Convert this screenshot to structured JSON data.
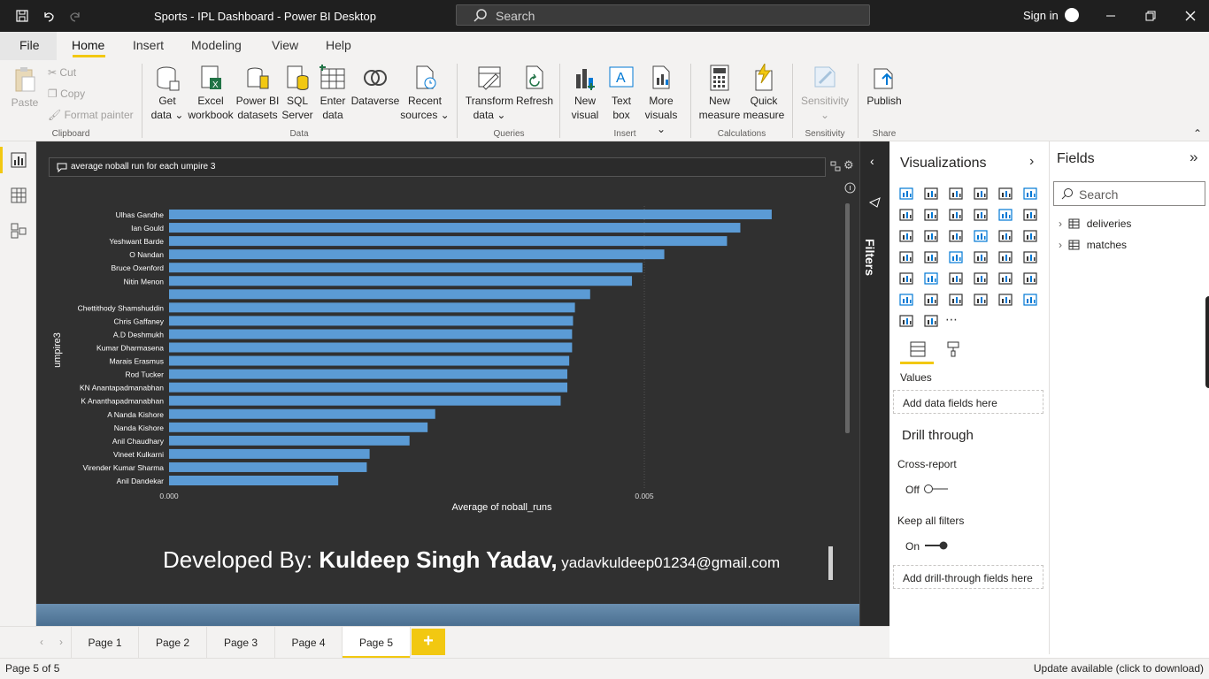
{
  "titlebar": {
    "title": "Sports - IPL Dashboard - Power BI Desktop",
    "search_placeholder": "Search",
    "signin": "Sign in"
  },
  "menu": {
    "file": "File",
    "home": "Home",
    "insert": "Insert",
    "modeling": "Modeling",
    "view": "View",
    "help": "Help"
  },
  "ribbon": {
    "paste": "Paste",
    "cut": "Cut",
    "copy": "Copy",
    "format_painter": "Format painter",
    "get_data": [
      "Get",
      "data ⌄"
    ],
    "excel": [
      "Excel",
      "workbook"
    ],
    "pbi_datasets": [
      "Power BI",
      "datasets"
    ],
    "sql": [
      "SQL",
      "Server"
    ],
    "enter_data": [
      "Enter",
      "data"
    ],
    "dataverse": "Dataverse",
    "recent": [
      "Recent",
      "sources ⌄"
    ],
    "transform": [
      "Transform",
      "data ⌄"
    ],
    "refresh": "Refresh",
    "new_visual": [
      "New",
      "visual"
    ],
    "text_box": [
      "Text",
      "box"
    ],
    "more_visuals": [
      "More",
      "visuals ⌄"
    ],
    "new_measure": [
      "New",
      "measure"
    ],
    "quick_measure": [
      "Quick",
      "measure"
    ],
    "sensitivity": "Sensitivity",
    "publish": "Publish",
    "groups": {
      "clipboard": "Clipboard",
      "data": "Data",
      "queries": "Queries",
      "insert": "Insert",
      "calculations": "Calculations",
      "sensitivity": "Sensitivity",
      "share": "Share"
    }
  },
  "qna": {
    "text": "average noball run for each umpire 3"
  },
  "chart_data": {
    "type": "bar",
    "orientation": "horizontal",
    "ylabel": "umpire3",
    "xlabel": "Average of noball_runs",
    "xticks": [
      "0.000",
      "0.005"
    ],
    "xlim": [
      0,
      0.0085
    ],
    "categories": [
      "Ulhas Gandhe",
      "Ian Gould",
      "Yeshwant Barde",
      "O Nandan",
      "Bruce Oxenford",
      "Nitin Menon",
      "",
      "Chettithody Shamshuddin",
      "Chris Gaffaney",
      "A.D Deshmukh",
      "Kumar Dharmasena",
      "Marais Erasmus",
      "Rod Tucker",
      "KN Anantapadmanabhan",
      "K Ananthapadmanabhan",
      "A Nanda Kishore",
      "Nanda Kishore",
      "Anil Chaudhary",
      "Vineet Kulkarni",
      "Virender Kumar Sharma",
      "Anil Dandekar"
    ],
    "values": [
      0.00634,
      0.00601,
      0.00587,
      0.00521,
      0.00498,
      0.00487,
      0.00443,
      0.00427,
      0.00425,
      0.00424,
      0.00424,
      0.00421,
      0.00419,
      0.00419,
      0.00412,
      0.0028,
      0.00272,
      0.00253,
      0.00211,
      0.00208,
      0.00178
    ],
    "bar_color": "#5b9bd5"
  },
  "credit": {
    "prefix": "Developed By: ",
    "name": "Kuldeep Singh Yadav,",
    "email": " yadavkuldeep01234@gmail.com"
  },
  "filters": {
    "label": "Filters"
  },
  "viz": {
    "title": "Visualizations",
    "values": "Values",
    "add_data": "Add data fields here",
    "drill": "Drill through",
    "cross": "Cross-report",
    "off": "Off",
    "keep": "Keep all filters",
    "on": "On",
    "add_drill": "Add drill-through fields here"
  },
  "fields": {
    "title": "Fields",
    "search": "Search",
    "tables": [
      "deliveries",
      "matches"
    ]
  },
  "pages": [
    "Page 1",
    "Page 2",
    "Page 3",
    "Page 4",
    "Page 5"
  ],
  "status": {
    "left": "Page 5 of 5",
    "right": "Update available (click to download)"
  }
}
